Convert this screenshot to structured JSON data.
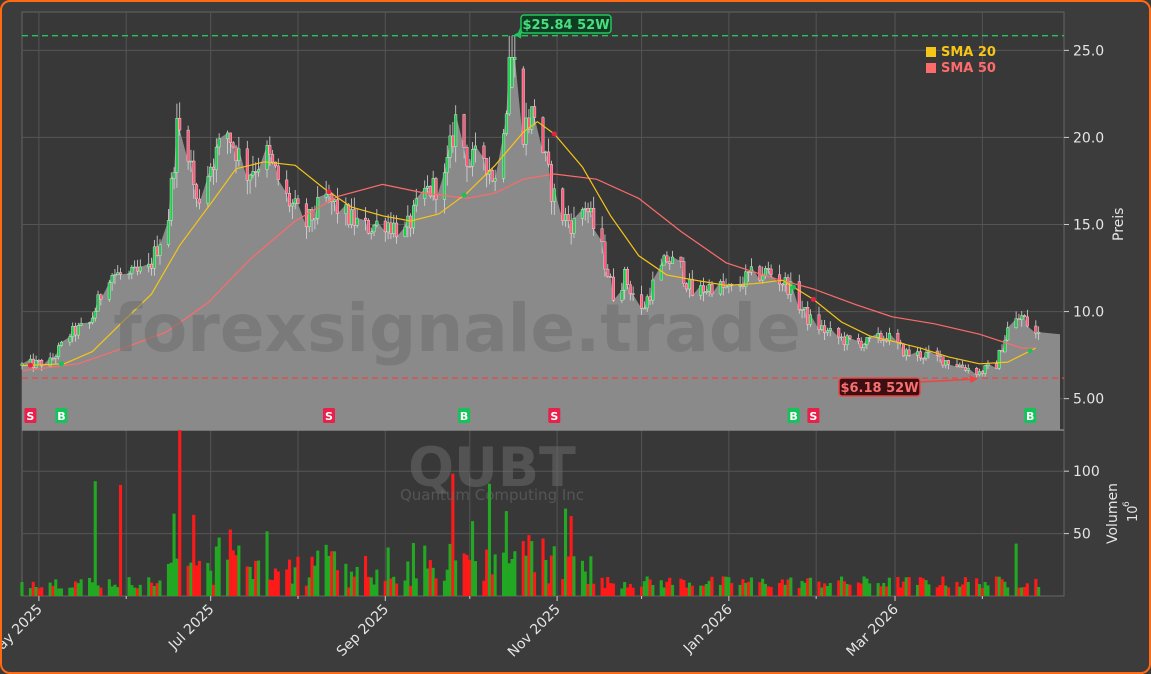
{
  "chart_data": {
    "type": "candlestick",
    "watermark": "forexsignale.trade",
    "ticker": "QUBT",
    "company": "Quantum Computing Inc",
    "price_axis": {
      "label": "Preis",
      "ylim": [
        3.2,
        27.2
      ],
      "ticks": [
        5.0,
        10.0,
        15.0,
        20.0,
        25.0
      ],
      "tick_labels": [
        "5.00",
        "10.0",
        "15.0",
        "20.0",
        "25.0"
      ]
    },
    "volume_axis": {
      "label": "Volumen",
      "exponent_label": "10",
      "exponent": "6",
      "ylim": [
        0,
        133
      ],
      "ticks": [
        50,
        100
      ],
      "tick_labels": [
        "50",
        "100"
      ]
    },
    "x_axis": {
      "range": [
        "2025-04-25",
        "2026-04-30"
      ],
      "ticks": [
        {
          "date": "2025-05-01",
          "label": "May 2025"
        },
        {
          "date": "2025-07-01",
          "label": "Jul 2025"
        },
        {
          "date": "2025-09-01",
          "label": "Sep 2025"
        },
        {
          "date": "2025-11-01",
          "label": "Nov 2025"
        },
        {
          "date": "2026-01-01",
          "label": "Jan 2026"
        },
        {
          "date": "2026-03-01",
          "label": "Mar 2026"
        }
      ],
      "minor_grid": [
        "2025-06-01",
        "2025-08-01",
        "2025-10-01",
        "2025-12-01",
        "2026-02-01",
        "2026-04-01"
      ]
    },
    "legend": {
      "position": "top-right",
      "items": [
        {
          "name": "SMA 20",
          "color": "#f5c518"
        },
        {
          "name": "SMA 50",
          "color": "#ff6b6b"
        }
      ]
    },
    "high_52w": {
      "value": 25.84,
      "label": "$25.84 52W",
      "date": "2025-10-16",
      "color": "#22c55e"
    },
    "low_52w": {
      "value": 6.18,
      "label": "$6.18 52W",
      "date": "2026-03-31",
      "color": "#ef4444"
    },
    "close_series": [
      [
        "2025-04-25",
        6.9
      ],
      [
        "2025-05-05",
        7.1
      ],
      [
        "2025-05-12",
        8.7
      ],
      [
        "2025-05-19",
        9.3
      ],
      [
        "2025-05-26",
        12.2
      ],
      [
        "2025-06-02",
        12.0
      ],
      [
        "2025-06-09",
        12.4
      ],
      [
        "2025-06-16",
        15.5
      ],
      [
        "2025-06-19",
        20.5
      ],
      [
        "2025-06-23",
        19.5
      ],
      [
        "2025-06-26",
        16.2
      ],
      [
        "2025-07-01",
        18.5
      ],
      [
        "2025-07-07",
        20.3
      ],
      [
        "2025-07-14",
        18.0
      ],
      [
        "2025-07-21",
        19.0
      ],
      [
        "2025-07-28",
        16.5
      ],
      [
        "2025-08-04",
        15.0
      ],
      [
        "2025-08-11",
        16.5
      ],
      [
        "2025-08-18",
        15.5
      ],
      [
        "2025-08-25",
        14.8
      ],
      [
        "2025-09-01",
        15.2
      ],
      [
        "2025-09-08",
        14.5
      ],
      [
        "2025-09-15",
        16.8
      ],
      [
        "2025-09-22",
        17.5
      ],
      [
        "2025-09-26",
        21.0
      ],
      [
        "2025-10-01",
        18.5
      ],
      [
        "2025-10-06",
        19.0
      ],
      [
        "2025-10-10",
        17.5
      ],
      [
        "2025-10-16",
        24.5
      ],
      [
        "2025-10-20",
        20.5
      ],
      [
        "2025-10-24",
        21.5
      ],
      [
        "2025-10-30",
        17.0
      ],
      [
        "2025-11-03",
        15.5
      ],
      [
        "2025-11-07",
        15.0
      ],
      [
        "2025-11-11",
        16.2
      ],
      [
        "2025-11-17",
        13.5
      ],
      [
        "2025-11-21",
        11.0
      ],
      [
        "2025-11-25",
        12.0
      ],
      [
        "2025-12-01",
        10.0
      ],
      [
        "2025-12-05",
        11.5
      ],
      [
        "2025-12-10",
        13.0
      ],
      [
        "2025-12-15",
        12.5
      ],
      [
        "2025-12-19",
        11.0
      ],
      [
        "2025-12-26",
        11.5
      ],
      [
        "2026-01-02",
        11.2
      ],
      [
        "2026-01-08",
        12.0
      ],
      [
        "2026-01-15",
        12.3
      ],
      [
        "2026-01-22",
        11.5
      ],
      [
        "2026-01-29",
        9.6
      ],
      [
        "2026-02-05",
        8.8
      ],
      [
        "2026-02-12",
        8.3
      ],
      [
        "2026-02-19",
        8.2
      ],
      [
        "2026-02-26",
        8.6
      ],
      [
        "2026-03-05",
        7.6
      ],
      [
        "2026-03-12",
        7.5
      ],
      [
        "2026-03-19",
        7.2
      ],
      [
        "2026-03-26",
        6.8
      ],
      [
        "2026-03-31",
        6.5
      ],
      [
        "2026-04-06",
        7.0
      ],
      [
        "2026-04-10",
        9.0
      ],
      [
        "2026-04-15",
        9.7
      ],
      [
        "2026-04-20",
        8.7
      ]
    ],
    "sma20": [
      [
        "2025-04-25",
        6.9
      ],
      [
        "2025-05-10",
        7.0
      ],
      [
        "2025-05-20",
        7.7
      ],
      [
        "2025-05-30",
        9.3
      ],
      [
        "2025-06-10",
        11.0
      ],
      [
        "2025-06-20",
        13.8
      ],
      [
        "2025-07-01",
        16.2
      ],
      [
        "2025-07-10",
        18.2
      ],
      [
        "2025-07-20",
        18.6
      ],
      [
        "2025-07-31",
        18.4
      ],
      [
        "2025-08-10",
        17.1
      ],
      [
        "2025-08-20",
        16.0
      ],
      [
        "2025-08-31",
        15.5
      ],
      [
        "2025-09-10",
        15.2
      ],
      [
        "2025-09-20",
        15.6
      ],
      [
        "2025-09-30",
        16.8
      ],
      [
        "2025-10-10",
        18.4
      ],
      [
        "2025-10-20",
        20.3
      ],
      [
        "2025-10-25",
        20.9
      ],
      [
        "2025-10-31",
        20.2
      ],
      [
        "2025-11-10",
        18.3
      ],
      [
        "2025-11-20",
        15.5
      ],
      [
        "2025-11-30",
        13.2
      ],
      [
        "2025-12-10",
        12.1
      ],
      [
        "2025-12-20",
        11.8
      ],
      [
        "2025-12-31",
        11.5
      ],
      [
        "2026-01-10",
        11.6
      ],
      [
        "2026-01-20",
        11.8
      ],
      [
        "2026-01-31",
        10.7
      ],
      [
        "2026-02-10",
        9.4
      ],
      [
        "2026-02-20",
        8.6
      ],
      [
        "2026-02-28",
        8.3
      ],
      [
        "2026-03-10",
        7.9
      ],
      [
        "2026-03-20",
        7.4
      ],
      [
        "2026-03-31",
        7.0
      ],
      [
        "2026-04-10",
        7.1
      ],
      [
        "2026-04-20",
        7.9
      ]
    ],
    "sma50": [
      [
        "2025-04-25",
        6.6
      ],
      [
        "2025-05-15",
        7.0
      ],
      [
        "2025-05-31",
        7.9
      ],
      [
        "2025-06-15",
        8.8
      ],
      [
        "2025-06-30",
        10.5
      ],
      [
        "2025-07-15",
        13.0
      ],
      [
        "2025-07-31",
        15.2
      ],
      [
        "2025-08-15",
        16.6
      ],
      [
        "2025-08-31",
        17.3
      ],
      [
        "2025-09-15",
        16.8
      ],
      [
        "2025-09-30",
        16.5
      ],
      [
        "2025-10-10",
        16.8
      ],
      [
        "2025-10-20",
        17.6
      ],
      [
        "2025-10-31",
        17.9
      ],
      [
        "2025-11-15",
        17.6
      ],
      [
        "2025-11-30",
        16.5
      ],
      [
        "2025-12-15",
        14.6
      ],
      [
        "2025-12-31",
        12.8
      ],
      [
        "2026-01-15",
        12.0
      ],
      [
        "2026-01-31",
        11.3
      ],
      [
        "2026-02-15",
        10.4
      ],
      [
        "2026-02-28",
        9.7
      ],
      [
        "2026-03-15",
        9.3
      ],
      [
        "2026-03-31",
        8.7
      ],
      [
        "2026-04-15",
        7.9
      ],
      [
        "2026-04-20",
        7.9
      ]
    ],
    "signals": [
      {
        "date": "2025-04-28",
        "type": "S"
      },
      {
        "date": "2025-05-09",
        "type": "B"
      },
      {
        "date": "2025-08-12",
        "type": "S"
      },
      {
        "date": "2025-09-29",
        "type": "B"
      },
      {
        "date": "2025-10-31",
        "type": "S"
      },
      {
        "date": "2026-01-24",
        "type": "B"
      },
      {
        "date": "2026-01-31",
        "type": "S"
      },
      {
        "date": "2026-04-18",
        "type": "B"
      }
    ],
    "volume_spikes": [
      [
        "2025-05-21",
        92
      ],
      [
        "2025-05-30",
        89
      ],
      [
        "2025-06-18",
        66
      ],
      [
        "2025-06-20",
        133
      ],
      [
        "2025-06-25",
        65
      ],
      [
        "2025-09-25",
        98
      ],
      [
        "2025-10-02",
        60
      ],
      [
        "2025-10-08",
        90
      ],
      [
        "2025-10-14",
        68
      ],
      [
        "2025-11-04",
        70
      ],
      [
        "2025-11-06",
        64
      ],
      [
        "2026-04-13",
        42
      ]
    ]
  }
}
